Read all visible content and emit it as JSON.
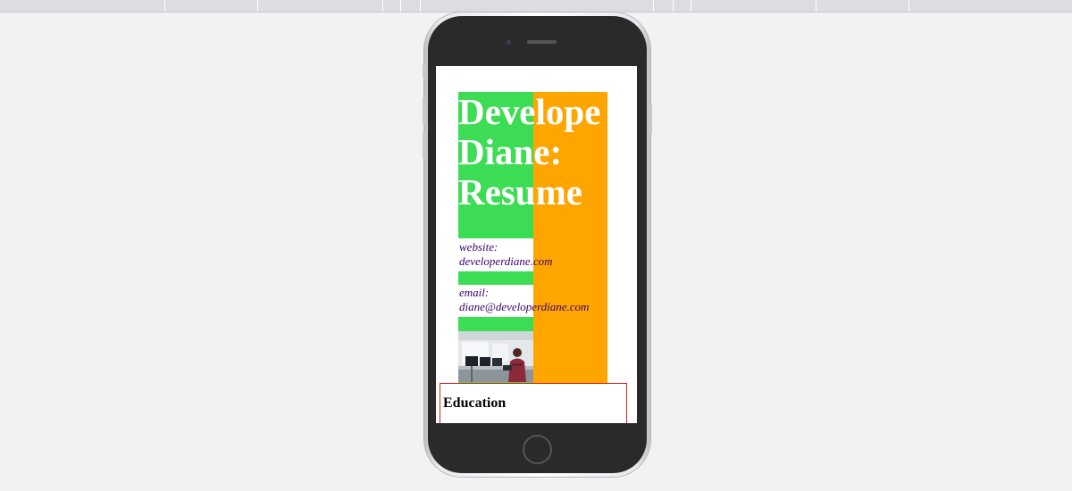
{
  "resume": {
    "headline_lines": [
      "Develope",
      "Diane:",
      "Resume"
    ],
    "website_label": "website:",
    "website_value": "developerdiane.com",
    "email_label": "email:",
    "email_value": "diane@developerdiane.com",
    "photo_alt": "photo of person at desk with monitors",
    "education_heading": "Education"
  },
  "colors": {
    "green": "#3cdc55",
    "orange": "#ffa500",
    "link": "#3a0070",
    "education_border": "#e02020"
  }
}
